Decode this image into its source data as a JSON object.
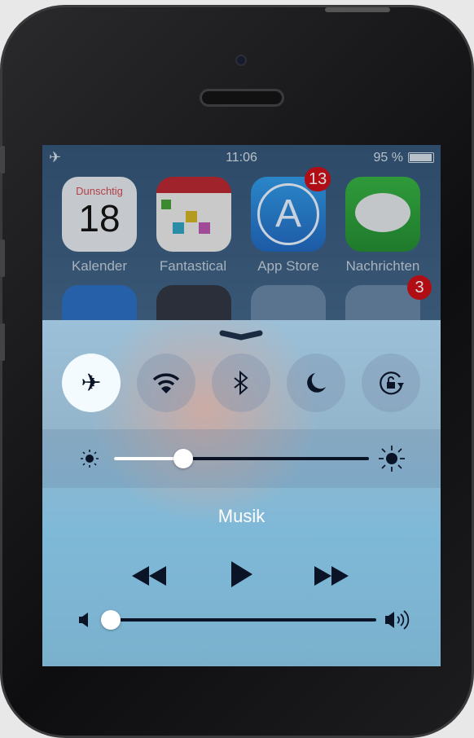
{
  "status_bar": {
    "airplane_icon": "airplane-icon",
    "time": "11:06",
    "battery_percent": "95 %",
    "battery_level": 95
  },
  "home_apps": [
    {
      "name": "Kalender",
      "date_day": "Dunschtig",
      "date_num": "18"
    },
    {
      "name": "Fantastical"
    },
    {
      "name": "App Store",
      "badge": "13"
    },
    {
      "name": "Nachrichten"
    }
  ],
  "second_row_badge": "3",
  "control_center": {
    "toggles": [
      {
        "name": "airplane-mode",
        "icon": "airplane-icon",
        "on": true
      },
      {
        "name": "wifi",
        "icon": "wifi-icon",
        "on": false
      },
      {
        "name": "bluetooth",
        "icon": "bluetooth-icon",
        "on": false
      },
      {
        "name": "do-not-disturb",
        "icon": "moon-icon",
        "on": false
      },
      {
        "name": "rotation-lock",
        "icon": "rotation-lock-icon",
        "on": false
      }
    ],
    "brightness": 0.27,
    "music_title": "Musik",
    "volume": 0.0
  }
}
